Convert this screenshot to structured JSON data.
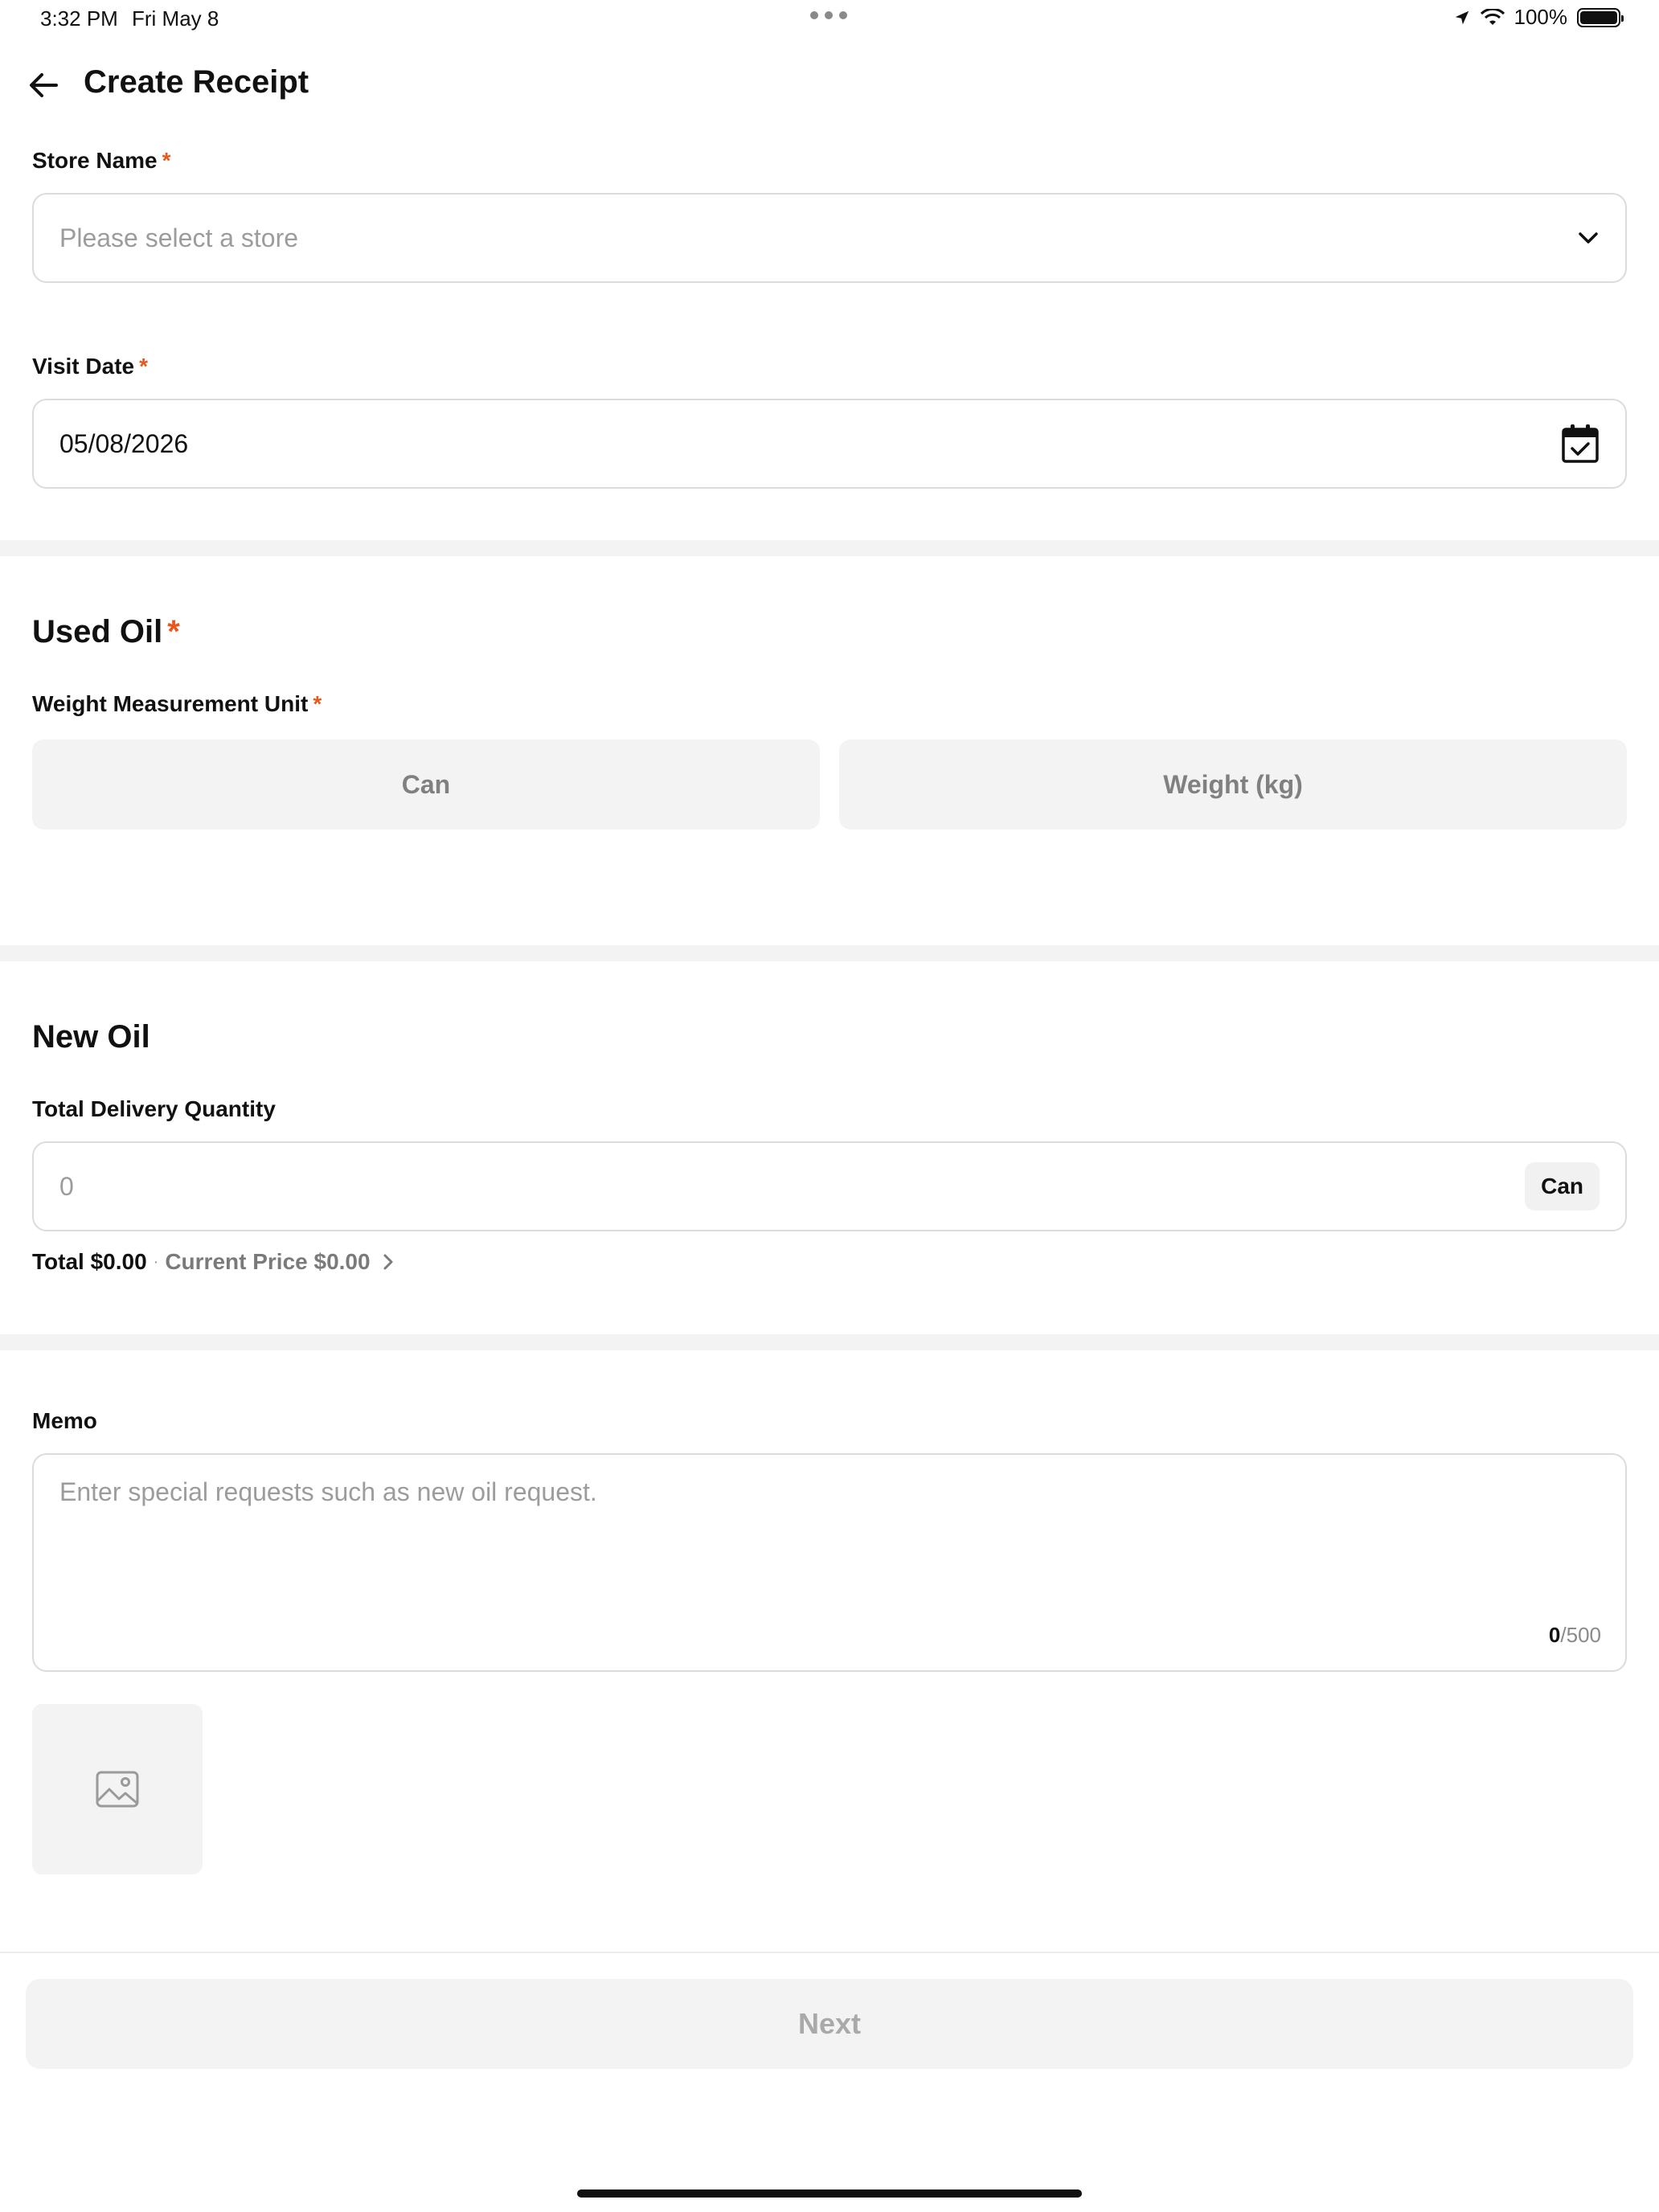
{
  "status_bar": {
    "time": "3:32 PM",
    "date": "Fri May 8",
    "battery": "100%",
    "icons": [
      "location-arrow-icon",
      "wifi-icon",
      "battery-icon"
    ]
  },
  "header": {
    "title": "Create Receipt",
    "back_icon": "arrow-left-icon"
  },
  "store": {
    "label": "Store Name",
    "required_mark": "*",
    "placeholder": "Please select a store",
    "icon": "chevron-down-icon"
  },
  "visit_date": {
    "label": "Visit Date",
    "required_mark": "*",
    "value": "05/08/2026",
    "icon": "calendar-check-icon"
  },
  "used_oil": {
    "title": "Used Oil",
    "required_mark": "*",
    "unit_label": "Weight Measurement Unit",
    "unit_required_mark": "*",
    "options": [
      "Can",
      "Weight (kg)"
    ]
  },
  "new_oil": {
    "title": "New Oil",
    "quantity_label": "Total Delivery Quantity",
    "quantity_placeholder": "0",
    "unit": "Can",
    "total": "Total $0.00",
    "separator": "·",
    "current_price": "Current Price $0.00"
  },
  "memo": {
    "label": "Memo",
    "placeholder": "Enter special requests such as new oil request.",
    "count": "0",
    "max": "/500"
  },
  "photo": {
    "icon": "image-icon"
  },
  "footer": {
    "next_label": "Next"
  },
  "colors": {
    "required": "#e8581d",
    "border": "#dcdcdc",
    "muted_bg": "#f3f3f3"
  }
}
